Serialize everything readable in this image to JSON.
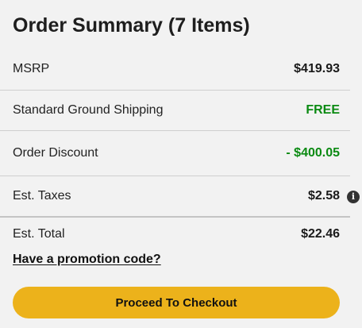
{
  "summary": {
    "title": "Order Summary (7 Items)",
    "rows": [
      {
        "label": "MSRP",
        "value": "$419.93"
      },
      {
        "label": "Standard Ground Shipping",
        "value": "FREE"
      },
      {
        "label": "Order Discount",
        "value": "- $400.05"
      },
      {
        "label": "Est. Taxes",
        "value": "$2.58"
      },
      {
        "label": "Est. Total",
        "value": "$22.46"
      }
    ],
    "info_icon": "info-circle-icon",
    "promo_link": "Have a promotion code?",
    "checkout_button": "Proceed To Checkout"
  },
  "colors": {
    "accent_button": "#ecb21b",
    "savings_green": "#0a8a12"
  }
}
